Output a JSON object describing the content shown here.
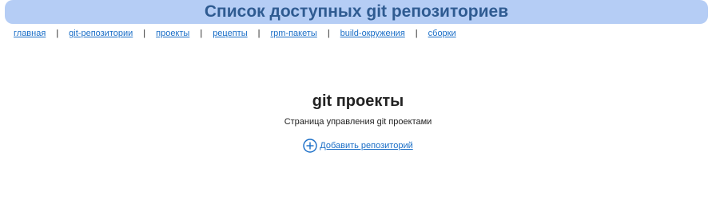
{
  "header": {
    "title": "Список доступных git репозиториев"
  },
  "nav": {
    "items": [
      {
        "label": "главная"
      },
      {
        "label": "git-репозитории"
      },
      {
        "label": "проекты"
      },
      {
        "label": "рецепты"
      },
      {
        "label": "rpm-пакеты"
      },
      {
        "label": "build-окружения"
      },
      {
        "label": "сборки"
      }
    ],
    "separator": "|"
  },
  "main": {
    "title": "git проекты",
    "subtitle": "Страница управления git проектами",
    "add_link": {
      "icon": "plus-circle-icon",
      "label": "Добавить репозиторий"
    }
  },
  "colors": {
    "header_bg": "#b5cdf5",
    "header_text": "#2f5b91",
    "link": "#1a6ec7"
  }
}
